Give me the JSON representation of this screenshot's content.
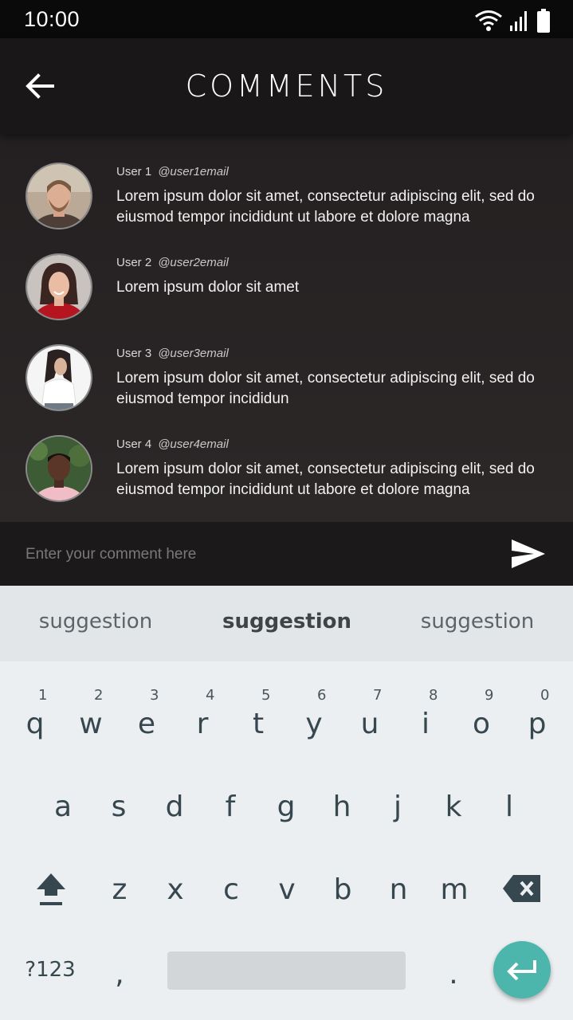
{
  "status_bar": {
    "time": "10:00",
    "icons": [
      "wifi-icon",
      "signal-icon",
      "battery-icon"
    ]
  },
  "app_bar": {
    "title": "COMMENTS",
    "back_icon": "arrow-left-icon"
  },
  "comments": [
    {
      "user": "User 1",
      "handle": "@user1email",
      "text": "Lorem ipsum dolor sit amet, consectetur adipiscing elit, sed do eiusmod tempor incididunt ut labore et dolore magna"
    },
    {
      "user": "User 2",
      "handle": "@user2email",
      "text": "Lorem ipsum dolor sit amet"
    },
    {
      "user": "User 3",
      "handle": "@user3email",
      "text": "Lorem ipsum dolor sit amet, consectetur adipiscing elit, sed do eiusmod tempor incididun"
    },
    {
      "user": "User 4",
      "handle": "@user4email",
      "text": "Lorem ipsum dolor sit amet, consectetur adipiscing elit, sed do eiusmod tempor incididunt ut labore et dolore magna"
    }
  ],
  "composer": {
    "placeholder": "Enter your comment here",
    "send_icon": "send-icon"
  },
  "keyboard": {
    "suggestions": [
      "suggestion",
      "suggestion",
      "suggestion"
    ],
    "row1": [
      {
        "k": "q",
        "n": "1"
      },
      {
        "k": "w",
        "n": "2"
      },
      {
        "k": "e",
        "n": "3"
      },
      {
        "k": "r",
        "n": "4"
      },
      {
        "k": "t",
        "n": "5"
      },
      {
        "k": "y",
        "n": "6"
      },
      {
        "k": "u",
        "n": "7"
      },
      {
        "k": "i",
        "n": "8"
      },
      {
        "k": "o",
        "n": "9"
      },
      {
        "k": "p",
        "n": "0"
      }
    ],
    "row2": [
      "a",
      "s",
      "d",
      "f",
      "g",
      "h",
      "j",
      "k",
      "l"
    ],
    "row3": [
      "z",
      "x",
      "c",
      "v",
      "b",
      "n",
      "m"
    ],
    "symbols_label": "?123",
    "comma": ",",
    "period": ".",
    "accent": "#4db6ac"
  }
}
